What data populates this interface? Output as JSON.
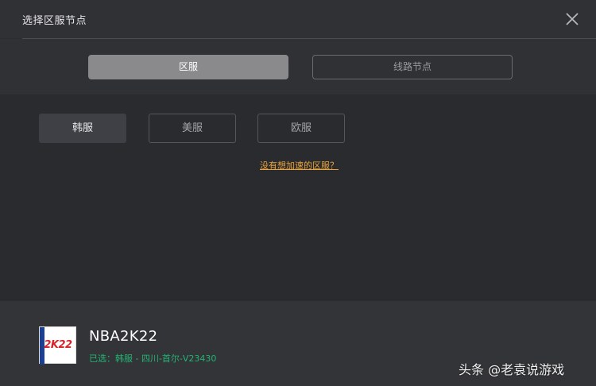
{
  "dialog": {
    "title": "选择区服节点"
  },
  "tabs": [
    {
      "label": "区服",
      "active": true
    },
    {
      "label": "线路节点",
      "active": false
    }
  ],
  "regions": [
    {
      "label": "韩服",
      "selected": true
    },
    {
      "label": "美服",
      "selected": false
    },
    {
      "label": "欧服",
      "selected": false
    }
  ],
  "help_link": "没有想加速的区服？",
  "footer": {
    "logo_text": "2K22",
    "game_name": "NBA2K22",
    "selected_node": "已选：韩服 - 四川-首尔-V23430"
  },
  "watermark": "头条 @老袁说游戏",
  "colors": {
    "accent_link": "#e8a33a",
    "selected_green": "#22b573",
    "active_tab": "#8a8a8d"
  },
  "icons": {
    "close": "close-icon"
  }
}
